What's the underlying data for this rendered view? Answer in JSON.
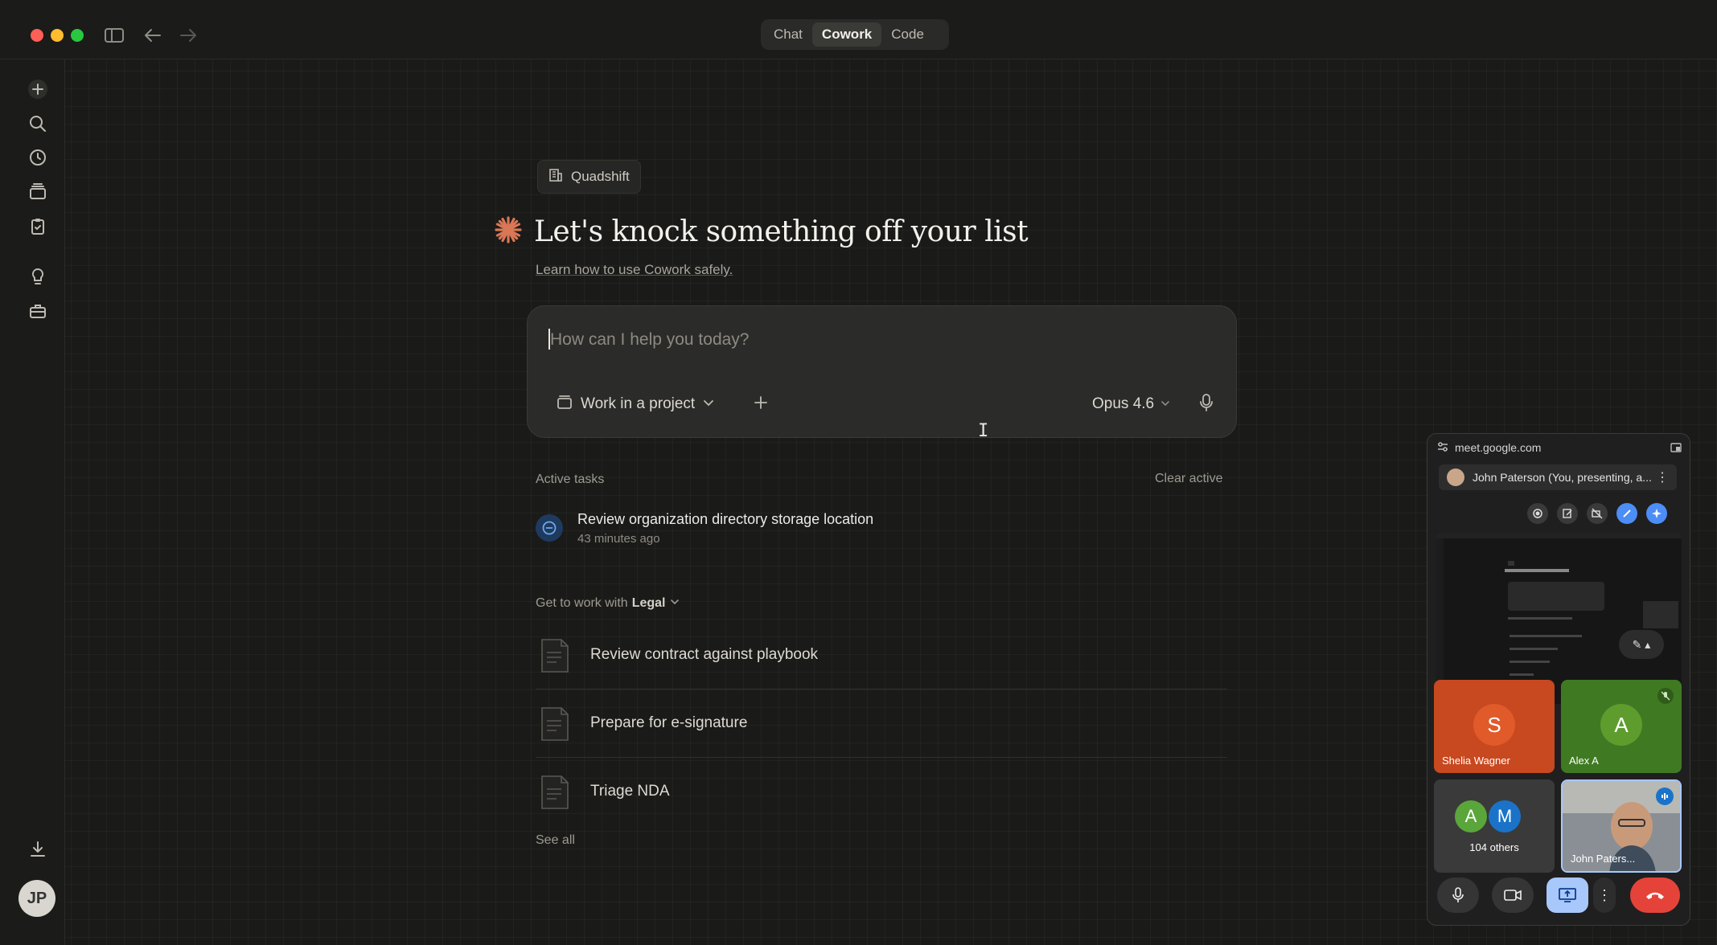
{
  "titlebar": {
    "tabs": [
      {
        "label": "Chat",
        "active": false
      },
      {
        "label": "Cowork",
        "active": true
      },
      {
        "label": "Code",
        "active": false
      }
    ]
  },
  "sidebar": {
    "icons": [
      "plus-icon",
      "search-icon",
      "clock-icon",
      "inbox-icon",
      "clipboard-icon",
      "lightbulb-icon",
      "toolbox-icon"
    ],
    "download_icon": "download-icon",
    "avatar_initials": "JP"
  },
  "main": {
    "project_chip": "Quadshift",
    "heading": "Let's knock something off your list",
    "learn_link": "Learn how to use Cowork safely.",
    "composer": {
      "placeholder": "How can I help you today?",
      "project_button": "Work in a project",
      "model": "Opus 4.6"
    },
    "active_tasks": {
      "label": "Active tasks",
      "clear_label": "Clear active",
      "items": [
        {
          "title": "Review organization directory storage location",
          "time": "43 minutes ago"
        }
      ]
    },
    "work_with": {
      "prefix": "Get to work with",
      "plugin": "Legal"
    },
    "skills": [
      {
        "label": "Review contract against playbook"
      },
      {
        "label": "Prepare for e-signature"
      },
      {
        "label": "Triage NDA"
      }
    ],
    "see_all": "See all"
  },
  "meet": {
    "url": "meet.google.com",
    "presenting": "John Paterson (You, presenting, a...",
    "tiles": [
      {
        "initial": "S",
        "name": "Shelia Wagner",
        "color": "#d24a1e",
        "bg": "#c8481f"
      },
      {
        "initial": "A",
        "name": "Alex A",
        "color": "#5e9d2d",
        "bg": "#3f7a22"
      },
      {
        "initial_a": "A",
        "initial_b": "M",
        "name": "104 others"
      },
      {
        "name": "John Paters..."
      }
    ]
  },
  "colors": {
    "background": "#1a1a18",
    "accent_orange": "#d97757",
    "close": "#fe5f57",
    "minimize": "#febc2e",
    "zoom": "#28c840"
  }
}
